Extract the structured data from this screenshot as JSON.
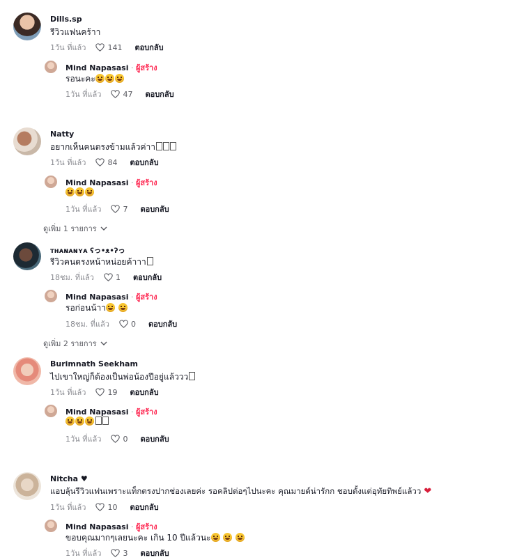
{
  "heart_icon": "heart-outline-icon",
  "chevron_icon": "chevron-down-icon",
  "threads": [
    {
      "comment": {
        "user": "Dills.sp",
        "text": "รีวิวแฟนคร้าา",
        "time": "1วัน ที่แล้ว",
        "likes": "141",
        "reply": "ตอบกลับ"
      },
      "reply": {
        "user": "Mind Napasasi",
        "sep": " · ",
        "badge": "ผู้สร้าง",
        "text": "รอนะคะ",
        "emoji_count": 3,
        "time": "1วัน ที่แล้ว",
        "likes": "47",
        "reply": "ตอบกลับ"
      }
    },
    {
      "comment": {
        "user": "Natty",
        "text": "อยากเห็นคนตรงข้ามแล้วค่าา",
        "time": "1วัน ที่แล้ว",
        "likes": "84",
        "reply": "ตอบกลับ"
      },
      "reply": {
        "user": "Mind Napasasi",
        "sep": " · ",
        "badge": "ผู้สร้าง",
        "text": "",
        "emoji_count": 3,
        "time": "1วัน ที่แล้ว",
        "likes": "7",
        "reply": "ตอบกลับ"
      },
      "more": "ดูเพิ่ม 1 รายการ"
    },
    {
      "comment": {
        "user": "ᴛʜᴀɴᴀɴʏᴀ ʕっ•ᴥ•ʔっ",
        "text": "รีวิวคนตรงหน้าหน่อยค้าาา",
        "time": "18ชม. ที่แล้ว",
        "likes": "1",
        "reply": "ตอบกลับ"
      },
      "reply": {
        "user": "Mind Napasasi",
        "sep": " · ",
        "badge": "ผู้สร้าง",
        "text": "รอก่อนน้าา",
        "emoji_count": 2,
        "time": "18ชม. ที่แล้ว",
        "likes": "0",
        "reply": "ตอบกลับ"
      },
      "more": "ดูเพิ่ม 2 รายการ"
    },
    {
      "comment": {
        "user": "Burimnath Seekham",
        "text": "ไปเขาใหญ่ก็ต้องเป็นพ่อน้องปีอยู่แล้ววว",
        "time": "1วัน ที่แล้ว",
        "likes": "19",
        "reply": "ตอบกลับ"
      },
      "reply": {
        "user": "Mind Napasasi",
        "sep": " · ",
        "badge": "ผู้สร้าง",
        "text": "",
        "emoji_count": 3,
        "time": "1วัน ที่แล้ว",
        "likes": "0",
        "reply": "ตอบกลับ"
      }
    },
    {
      "comment": {
        "user": "Nitcha ♥",
        "text": "แอบลุ้นรีวิวแฟนเพราะแท็กตรงปากช่องเลยค่ะ รอคลิปต่อๆไปนะคะ คุณมายด์น่ารักก ชอบตั้งแต่อุทัยทิพย์แล้วว",
        "time": "1วัน ที่แล้ว",
        "likes": "10",
        "reply": "ตอบกลับ"
      },
      "reply": {
        "user": "Mind Napasasi",
        "sep": " · ",
        "badge": "ผู้สร้าง",
        "text": "ขอบคุณมากๆเลยนะคะ เกิน 10 ปีแล้วนะ",
        "emoji_count": 3,
        "time": "1วัน ที่แล้ว",
        "likes": "3",
        "reply": "ตอบกลับ"
      }
    }
  ]
}
